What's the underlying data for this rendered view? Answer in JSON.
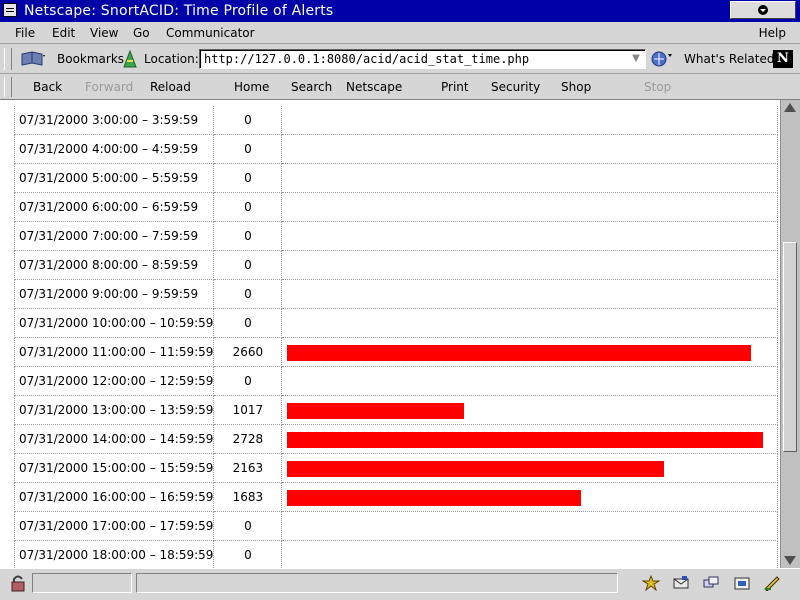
{
  "window": {
    "title": "Netscape: SnortACID: Time Profile of Alerts"
  },
  "menu": {
    "items": [
      "File",
      "Edit",
      "View",
      "Go",
      "Communicator"
    ],
    "help": "Help"
  },
  "location_bar": {
    "bookmarks_label": "Bookmarks",
    "location_label": "Location:",
    "url": "http://127.0.0.1:8080/acid/acid_stat_time.php",
    "whats_related_label": "What's Related",
    "logo_letter": "N"
  },
  "nav": {
    "back": "Back",
    "forward": "Forward",
    "reload": "Reload",
    "home": "Home",
    "search": "Search",
    "netscape": "Netscape",
    "print": "Print",
    "security": "Security",
    "shop": "Shop",
    "stop": "Stop"
  },
  "table": {
    "bar_color": "#ff0000",
    "max_count": 2728,
    "rows": [
      {
        "time": "07/31/2000 3:00:00 – 3:59:59",
        "count": 0
      },
      {
        "time": "07/31/2000 4:00:00 – 4:59:59",
        "count": 0
      },
      {
        "time": "07/31/2000 5:00:00 – 5:59:59",
        "count": 0
      },
      {
        "time": "07/31/2000 6:00:00 – 6:59:59",
        "count": 0
      },
      {
        "time": "07/31/2000 7:00:00 – 7:59:59",
        "count": 0
      },
      {
        "time": "07/31/2000 8:00:00 – 8:59:59",
        "count": 0
      },
      {
        "time": "07/31/2000 9:00:00 – 9:59:59",
        "count": 0
      },
      {
        "time": "07/31/2000 10:00:00 – 10:59:59",
        "count": 0
      },
      {
        "time": "07/31/2000 11:00:00 – 11:59:59",
        "count": 2660
      },
      {
        "time": "07/31/2000 12:00:00 – 12:59:59",
        "count": 0
      },
      {
        "time": "07/31/2000 13:00:00 – 13:59:59",
        "count": 1017
      },
      {
        "time": "07/31/2000 14:00:00 – 14:59:59",
        "count": 2728
      },
      {
        "time": "07/31/2000 15:00:00 – 15:59:59",
        "count": 2163
      },
      {
        "time": "07/31/2000 16:00:00 – 16:59:59",
        "count": 1683
      },
      {
        "time": "07/31/2000 17:00:00 – 17:59:59",
        "count": 0
      },
      {
        "time": "07/31/2000 18:00:00 – 18:59:59",
        "count": 0
      }
    ]
  }
}
